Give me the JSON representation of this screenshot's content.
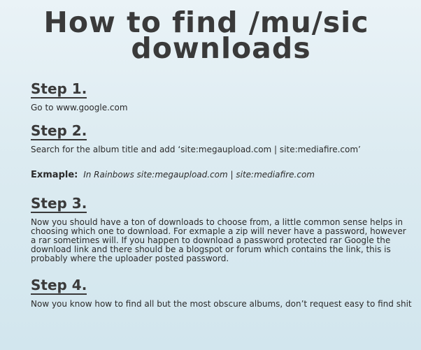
{
  "title": {
    "line1": "How to find /mu/sic",
    "line2": "downloads"
  },
  "steps": [
    {
      "heading": "Step 1.",
      "text": "Go to www.google.com"
    },
    {
      "heading": "Step 2.",
      "text": "Search for the album title and add ‘site:megaupload.com  |  site:mediafire.com’"
    },
    {
      "heading": "Step 3.",
      "text": "Now you should have a ton of downloads to choose from, a little common sense helps in choosing which one to download. For exmaple a zip will never have a password, however a rar sometimes will. If you happen to download a password protected rar Google the download link and there should be a blogspot or forum which contains the link, this is probably where the uploader posted password."
    },
    {
      "heading": "Step 4.",
      "text": "Now you know how to find all but the most obscure albums, don’t request easy to find shit"
    }
  ],
  "example": {
    "label": "Exmaple:",
    "text": "In Rainbows site:megaupload.com  |  site:mediafire.com"
  }
}
